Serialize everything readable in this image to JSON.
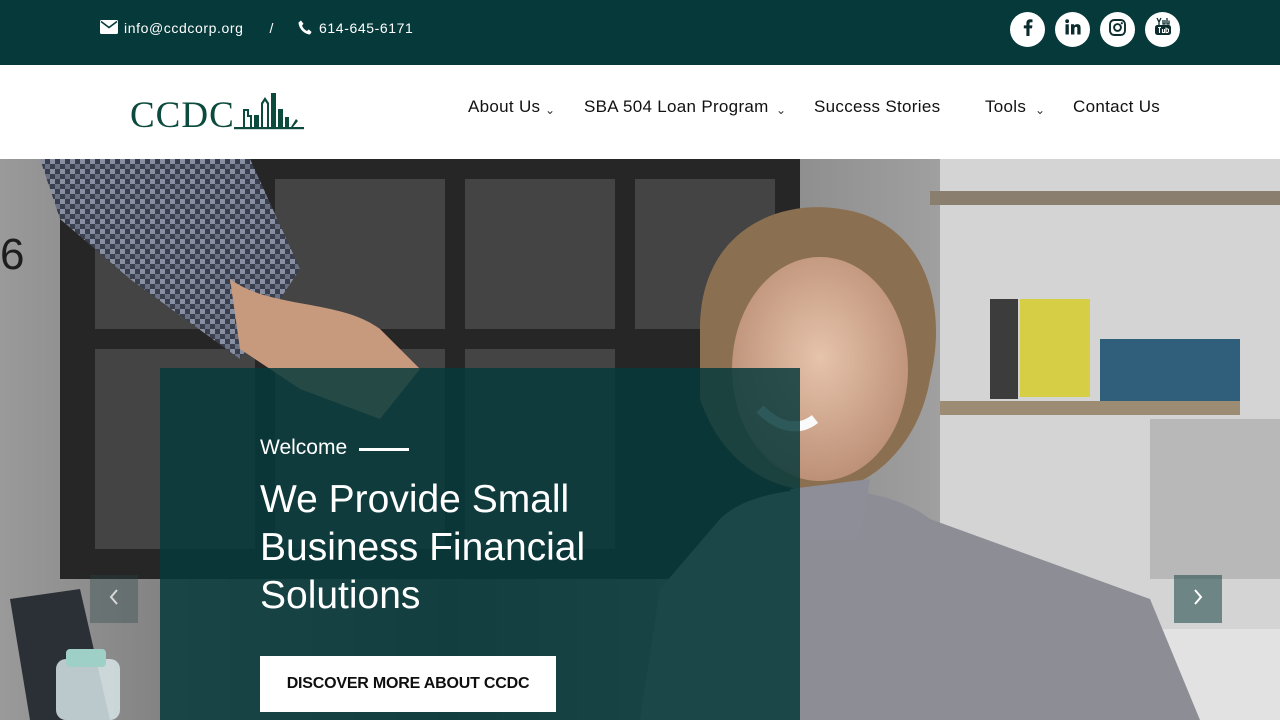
{
  "topbar": {
    "email": "info@ccdcorp.org",
    "separator": "/",
    "phone": "614-645-6171",
    "email_icon": "envelope-icon",
    "phone_icon": "phone-icon",
    "socials": [
      {
        "name": "facebook-icon"
      },
      {
        "name": "linkedin-icon"
      },
      {
        "name": "instagram-icon"
      },
      {
        "name": "youtube-icon"
      }
    ]
  },
  "nav": {
    "logo_text": "CCDC",
    "items": [
      {
        "label": "About Us",
        "dropdown": true
      },
      {
        "label": "SBA 504 Loan Program",
        "dropdown": true
      },
      {
        "label": "Success Stories",
        "dropdown": false
      },
      {
        "label": "Tools",
        "dropdown": true
      },
      {
        "label": "Contact Us",
        "dropdown": false
      }
    ],
    "caret": "⌄"
  },
  "hero": {
    "eyebrow": "Welcome",
    "headline": "We Provide Small Business Financial Solutions",
    "cta_label": "DISCOVER MORE ABOUT CCDC",
    "prev_icon": "chevron-left-icon",
    "next_icon": "chevron-right-icon"
  },
  "colors": {
    "brand_dark": "#06393a",
    "white": "#ffffff"
  }
}
